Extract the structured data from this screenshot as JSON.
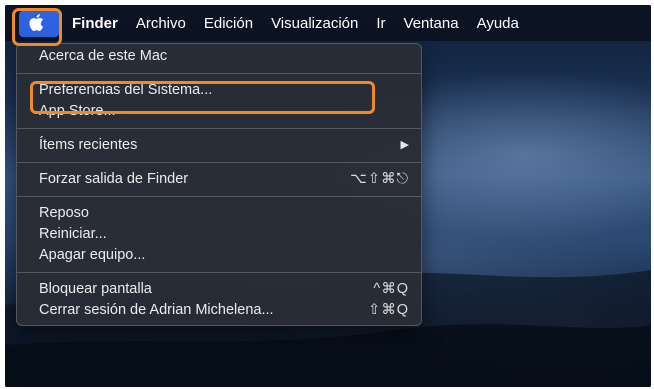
{
  "menubar": {
    "app_name": "Finder",
    "menus": [
      "Archivo",
      "Edición",
      "Visualización",
      "Ir",
      "Ventana",
      "Ayuda"
    ]
  },
  "apple_menu": {
    "about": "Acerca de este Mac",
    "system_prefs": "Preferencias del Sistema...",
    "app_store": "App Store...",
    "recent_items": "Ítems recientes",
    "force_quit": "Forzar salida de Finder",
    "force_quit_shortcut": "⌥⇧⌘⎋",
    "sleep": "Reposo",
    "restart": "Reiniciar...",
    "shutdown": "Apagar equipo...",
    "lock_screen": "Bloquear pantalla",
    "lock_screen_shortcut": "^⌘Q",
    "log_out": "Cerrar sesión de Adrian Michelena...",
    "log_out_shortcut": "⇧⌘Q"
  },
  "colors": {
    "highlight": "#f08a28",
    "apple_selected": "#2d63e0"
  }
}
